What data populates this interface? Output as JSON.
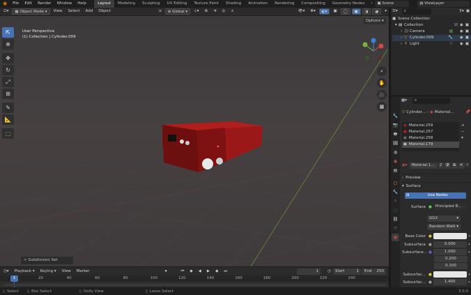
{
  "topbar": {
    "menus": [
      "File",
      "Edit",
      "Render",
      "Window",
      "Help"
    ],
    "workspaces": [
      "Layout",
      "Modeling",
      "Sculpting",
      "UV Editing",
      "Texture Paint",
      "Shading",
      "Animation",
      "Rendering",
      "Compositing",
      "Geometry Nodes"
    ],
    "active_workspace": "Layout",
    "scene": "Scene",
    "view_layer": "ViewLayer"
  },
  "viewport_header": {
    "mode": "Object Mode",
    "menus": [
      "View",
      "Select",
      "Add",
      "Object"
    ],
    "orientation": "Global",
    "options": "Options"
  },
  "viewport": {
    "perspective": "User Perspective",
    "collection_info": "(1) Collection | Cylinder.009",
    "operator_panel": "> Subdivision Set"
  },
  "outliner": {
    "root": "Scene Collection",
    "collection": "Collection",
    "items": [
      "Camera",
      "Cylinder.009",
      "Light"
    ]
  },
  "properties": {
    "object_name": "Cylinder...",
    "material_name": "Material...",
    "slots": [
      "Material.259",
      "Material.257",
      "Material.258",
      "Material.179"
    ],
    "selected_slot": "Material.179",
    "material_field": "Material.1...",
    "material_users": "2",
    "preview_label": "Preview",
    "surface_label": "Surface",
    "use_nodes": "Use Nodes",
    "surface_field_label": "Surface",
    "surface_shader": "Principled B...",
    "distribution": "GGX",
    "subsurface_method": "Random Walk",
    "base_color_label": "Base Color",
    "subsurface_label": "Subsurface",
    "subsurface_value": "0.000",
    "subsurface_radius_label": "Subsurface...",
    "radius_values": [
      "1.000",
      "0.200",
      "0.100"
    ],
    "subsurface_color_label": "Subsurfac...",
    "subsurface_ior_label": "Subsurfac...",
    "subsurface_ior": "1.400",
    "colors": {
      "base": "#e6e6e6",
      "subsurface_color": "#e6e6e6"
    }
  },
  "timeline": {
    "menus": [
      "Playback",
      "Keying",
      "View",
      "Marker"
    ],
    "current_frame": "1",
    "start_label": "Start",
    "start": "1",
    "end_label": "End",
    "end": "250",
    "ticks": [
      "20",
      "40",
      "60",
      "80",
      "100",
      "120",
      "140",
      "160",
      "180",
      "200",
      "220",
      "240"
    ],
    "playhead": "1"
  },
  "statusbar": {
    "items": [
      "Select",
      "Box Select",
      "Dolly View",
      "Lasso Select"
    ],
    "version": "3.0.0"
  }
}
